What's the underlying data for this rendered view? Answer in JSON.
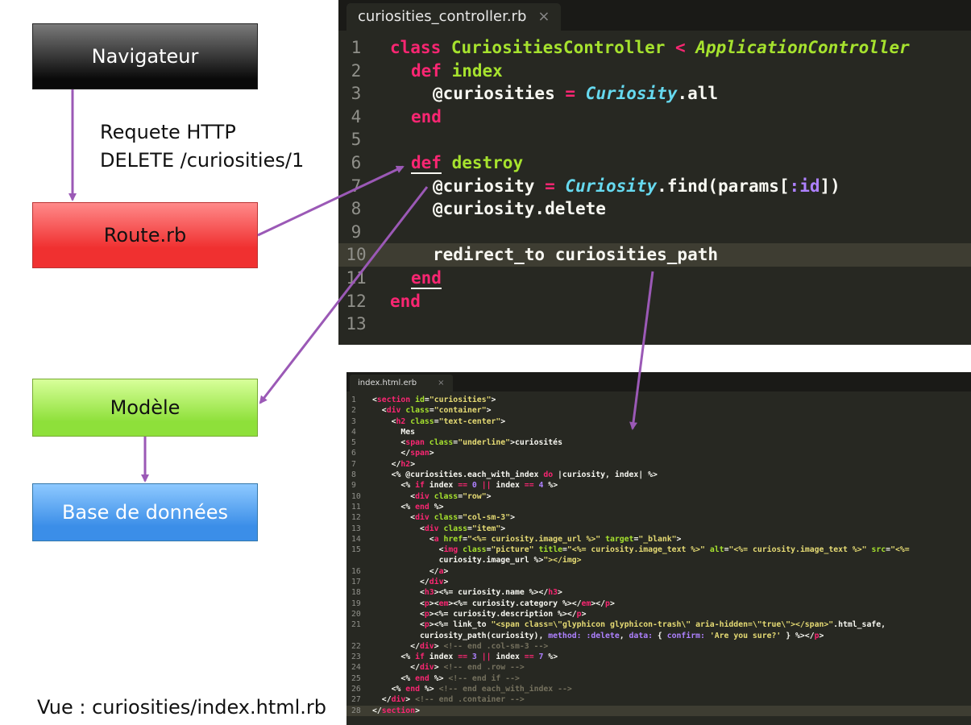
{
  "boxes": {
    "navigator": "Navigateur",
    "route": "Route.rb",
    "model": "Modèle",
    "database": "Base de données"
  },
  "labels": {
    "request_line1": "Requete HTTP",
    "request_line2": "DELETE /curiosities/1",
    "view": "Vue : curiosities/index.html.rb"
  },
  "controller_editor": {
    "tab_name": "curiosities_controller.rb",
    "tab_close": "×",
    "line_numbers": [
      "1",
      "2",
      "3",
      "4",
      "5",
      "6",
      "7",
      "8",
      "9",
      "10",
      "11",
      "12",
      "13"
    ],
    "code": {
      "l1_class": "class",
      "l1_name": " CuriositiesController ",
      "l1_lt": "<",
      "l1_parent": " ApplicationController",
      "l2_def": "def",
      "l2_name": " index",
      "l3_ivar": "@curiosities ",
      "l3_eq": "=",
      "l3_model": " Curiosity",
      "l3_call": ".all",
      "l4_end": "end",
      "l6_def": "def",
      "l6_name": " destroy",
      "l7_ivar": "@curiosity ",
      "l7_eq": "=",
      "l7_model": " Curiosity",
      "l7_call": ".find(params[",
      "l7_sym": ":id",
      "l7_close": "])",
      "l8_text": "@curiosity.delete",
      "l10_text": "redirect_to curiosities_path",
      "l11_end": "end",
      "l12_end": "end"
    }
  },
  "view_editor": {
    "tab_name": "index.html.erb",
    "tab_close": "×",
    "line_numbers": [
      "1",
      "2",
      "3",
      "4",
      "5",
      "6",
      "7",
      "8",
      "9",
      "10",
      "11",
      "12",
      "13",
      "14",
      "15",
      "",
      "16",
      "17",
      "18",
      "19",
      "20",
      "21",
      "",
      "22",
      "23",
      "24",
      "25",
      "26",
      "27",
      "28"
    ],
    "lines": [
      "<section id=\"curiosities\">",
      "  <div class=\"container\">",
      "    <h2 class=\"text-center\">",
      "      Mes",
      "      <span class=\"underline\">curiosités",
      "      </span>",
      "    </h2>",
      "    <% @curiosities.each_with_index do |curiosity, index| %>",
      "      <% if index == 0 || index == 4 %>",
      "        <div class=\"row\">",
      "      <% end %>",
      "        <div class=\"col-sm-3\">",
      "          <div class=\"item\">",
      "            <a href=\"<%= curiosity.image_url %>\" target=\"_blank\">",
      "              <img class=\"picture\" title=\"<%= curiosity.image_text %>\" alt=\"<%= curiosity.image_text %>\" src=\"<%=",
      "              curiosity.image_url %>\"></img>",
      "            </a>",
      "          </div>",
      "          <h3><%= curiosity.name %></h3>",
      "          <p><em><%= curiosity.category %></em></p>",
      "          <p><%= curiosity.description %></p>",
      "          <p><%= link_to \"<span class=\\\"glyphicon glyphicon-trash\\\" aria-hidden=\\\"true\\\"></span>\".html_safe,",
      "          curiosity_path(curiosity), method: :delete, data: { confirm: 'Are you sure?' } %></p>",
      "        </div> <!-- end .col-sm-3 -->",
      "      <% if index == 3 || index == 7 %>",
      "        </div> <!-- end .row -->",
      "      <% end %> <!-- end if -->",
      "    <% end %> <!-- end each_with_index -->",
      "  </div> <!-- end .container -->",
      "</section>"
    ]
  },
  "colors": {
    "editor_bg": "#272822",
    "arrow": "#9b59b6"
  }
}
